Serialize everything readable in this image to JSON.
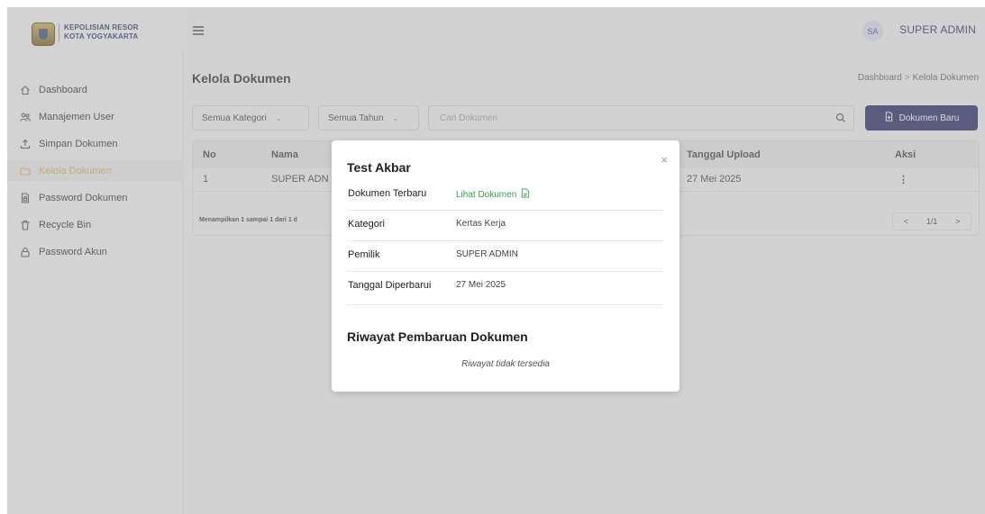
{
  "brand": {
    "line1": "KEPOLISIAN RESOR",
    "line2": "KOTA YOGYAKARTA"
  },
  "sidebar": {
    "items": [
      {
        "label": "Dashboard",
        "icon": "home-icon",
        "active": false
      },
      {
        "label": "Manajemen User",
        "icon": "users-icon",
        "active": false
      },
      {
        "label": "Simpan Dokumen",
        "icon": "upload-icon",
        "active": false
      },
      {
        "label": "Kelola Dokumen",
        "icon": "folder-icon",
        "active": true
      },
      {
        "label": "Password Dokumen",
        "icon": "file-lock-icon",
        "active": false
      },
      {
        "label": "Recycle Bin",
        "icon": "trash-icon",
        "active": false
      },
      {
        "label": "Password Akun",
        "icon": "lock-icon",
        "active": false
      }
    ]
  },
  "header": {
    "avatar_initials": "SA",
    "username": "SUPER ADMIN"
  },
  "page": {
    "title": "Kelola Dokumen",
    "breadcrumb": [
      "Dashboard",
      "Kelola Dokumen"
    ],
    "breadcrumb_sep": ">"
  },
  "filters": {
    "category": "Semua Kategori",
    "year": "Semua Tahun",
    "search_placeholder": "Cari Dokumen",
    "new_button": "Dokumen Baru"
  },
  "table": {
    "columns": {
      "no": "No",
      "name": "Nama",
      "upload_date": "Tanggal Upload",
      "action": "Aksi"
    },
    "rows": [
      {
        "no": "1",
        "name": "SUPER ADN",
        "upload_date": "27 Mei 2025",
        "action": "⋮"
      }
    ],
    "footer_info": "Menampilkan 1 sampai 1 dari 1 d",
    "pager": {
      "prev": "<",
      "page": "1/1",
      "next": ">"
    }
  },
  "modal": {
    "title": "Test Akbar",
    "rows": [
      {
        "key": "Dokumen Terbaru",
        "value": "Lihat Dokumen"
      },
      {
        "key": "Kategori",
        "value": "Kertas Kerja"
      },
      {
        "key": "Pemilik",
        "value": "SUPER ADMIN"
      },
      {
        "key": "Tanggal Diperbarui",
        "value": "27 Mei 2025"
      }
    ],
    "history_title": "Riwayat Pembaruan Dokumen",
    "history_empty": "Riwayat tidak tersedia",
    "close": "×"
  },
  "colors": {
    "primary": "#1b1b5e",
    "active_nav": "#e0a94a",
    "link": "#2da44e"
  }
}
